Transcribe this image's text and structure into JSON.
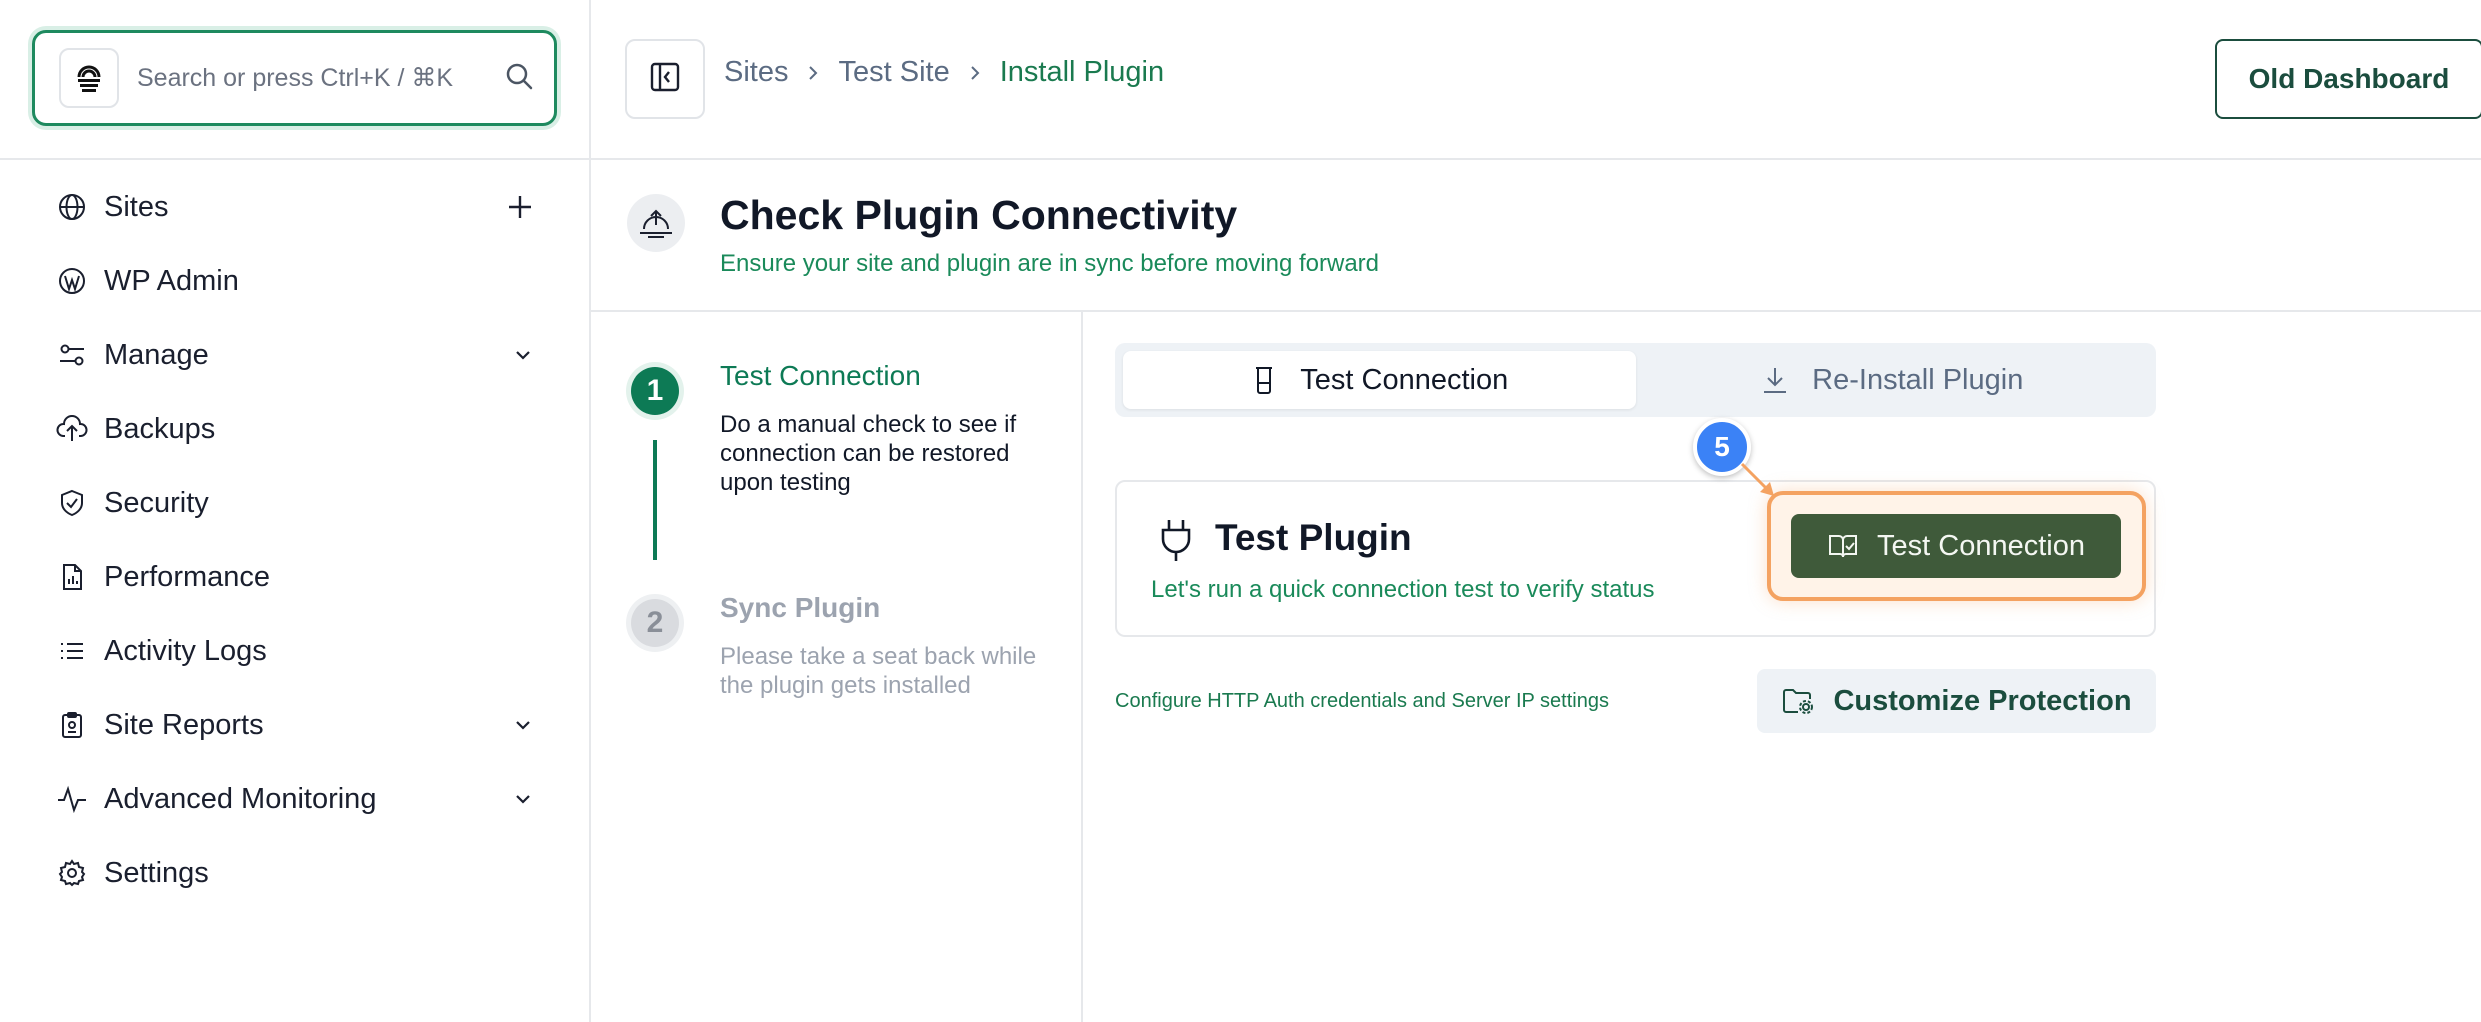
{
  "search": {
    "placeholder": "Search or press Ctrl+K / ⌘K"
  },
  "sidebar": {
    "items": [
      {
        "label": "Sites",
        "icon": "globe-icon",
        "trail": "plus-icon"
      },
      {
        "label": "WP Admin",
        "icon": "wordpress-icon"
      },
      {
        "label": "Manage",
        "icon": "sliders-icon",
        "trail": "chevron-down-icon"
      },
      {
        "label": "Backups",
        "icon": "cloud-upload-icon"
      },
      {
        "label": "Security",
        "icon": "shield-icon"
      },
      {
        "label": "Performance",
        "icon": "document-chart-icon"
      },
      {
        "label": "Activity Logs",
        "icon": "list-icon"
      },
      {
        "label": "Site Reports",
        "icon": "report-icon",
        "trail": "chevron-down-icon"
      },
      {
        "label": "Advanced Monitoring",
        "icon": "activity-icon",
        "trail": "chevron-down-icon"
      },
      {
        "label": "Settings",
        "icon": "gear-icon"
      }
    ]
  },
  "header": {
    "breadcrumb": [
      "Sites",
      "Test Site",
      "Install Plugin"
    ],
    "old_dashboard": "Old Dashboard"
  },
  "page": {
    "title": "Check Plugin Connectivity",
    "subtitle": "Ensure your site and plugin are in sync before moving forward"
  },
  "steps": [
    {
      "number": "1",
      "title": "Test Connection",
      "description": "Do a manual check to see if connection can be restored upon testing",
      "state": "active"
    },
    {
      "number": "2",
      "title": "Sync Plugin",
      "description": "Please take a seat back while the plugin gets installed",
      "state": "pending"
    }
  ],
  "tabs": [
    {
      "label": "Test Connection",
      "icon": "beaker-icon",
      "selected": true
    },
    {
      "label": "Re-Install Plugin",
      "icon": "download-icon",
      "selected": false
    }
  ],
  "test_card": {
    "title": "Test Plugin",
    "subtitle": "Let's run a quick connection test to verify status",
    "button": "Test Connection"
  },
  "annotation": {
    "step_badge": "5"
  },
  "config": {
    "text": "Configure HTTP Auth credentials and Server IP settings",
    "button": "Customize Protection"
  },
  "colors": {
    "brand_green": "#0d7a55",
    "button_dark_green": "#3f5a3a",
    "highlight_orange": "#f4a261",
    "badge_blue": "#3b82f6"
  }
}
